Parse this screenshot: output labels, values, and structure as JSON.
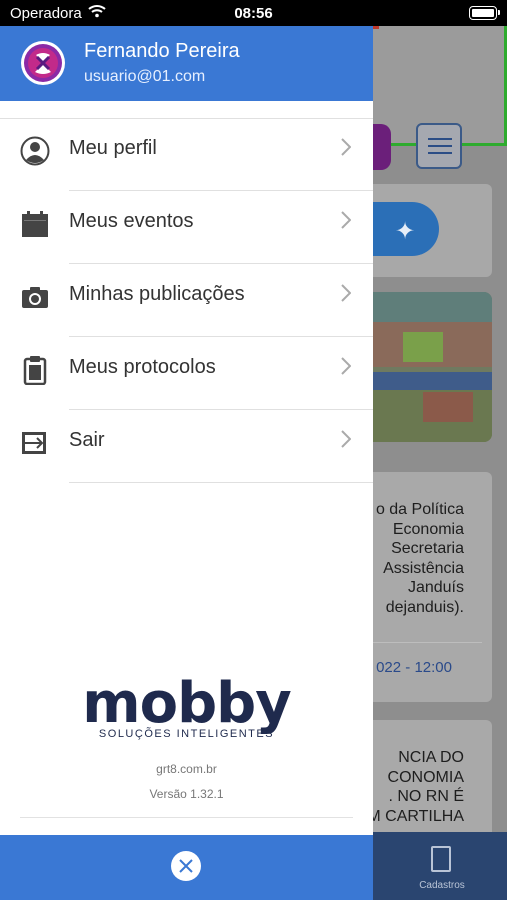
{
  "status_bar": {
    "carrier": "Operadora",
    "time": "08:56"
  },
  "user": {
    "name": "Fernando Pereira",
    "email": "usuario@01.com"
  },
  "menu": [
    {
      "label": "Meu perfil",
      "icon": "user-circle-icon"
    },
    {
      "label": "Meus eventos",
      "icon": "calendar-icon"
    },
    {
      "label": "Minhas publicações",
      "icon": "camera-icon"
    },
    {
      "label": "Meus protocolos",
      "icon": "clipboard-icon"
    },
    {
      "label": "Sair",
      "icon": "logout-icon"
    }
  ],
  "brand": {
    "logo": "mobby",
    "tagline": "SOLUÇÕES INTELIGENTES"
  },
  "footer": {
    "site": "grt8.com.br",
    "version": "Versão 1.32.1"
  },
  "background": {
    "article1_lines": "o da Política\n Economia\nSecretaria\nAssistência\nJanduís\ndejanduis).",
    "article1_date": "022 - 12:00",
    "article2_lines": "NCIA DO\nCONOMIA\n. NO RN É\nM CARTILHA",
    "tab_label": "Cadastros"
  },
  "colors": {
    "primary": "#3a78d4",
    "brand_dark": "#1f2a4d",
    "accent_purple": "#8b2aa6"
  }
}
